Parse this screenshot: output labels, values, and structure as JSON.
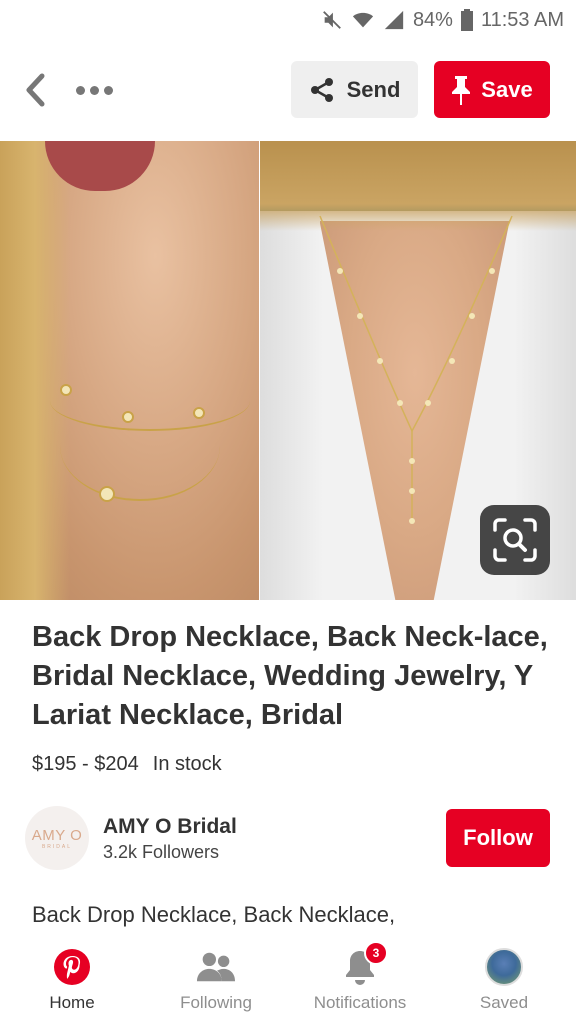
{
  "status_bar": {
    "battery": "84%",
    "time": "11:53 AM"
  },
  "toolbar": {
    "send_label": "Send",
    "save_label": "Save"
  },
  "pin": {
    "title": "Back Drop Necklace, Back Neck-lace, Bridal Necklace, Wedding Jewelry, Y Lariat Necklace, Bridal",
    "price": "$195 - $204",
    "stock": "In stock",
    "description": "Back Drop Necklace, Back Necklace,"
  },
  "creator": {
    "logo_text": "AMY O",
    "logo_sub": "BRIDAL",
    "name": "AMY O Bridal",
    "followers": "3.2k Followers",
    "follow_label": "Follow"
  },
  "bottom_nav": {
    "items": [
      {
        "label": "Home",
        "icon": "pinterest-logo-icon",
        "active": true
      },
      {
        "label": "Following",
        "icon": "people-icon",
        "active": false
      },
      {
        "label": "Notifications",
        "icon": "bell-icon",
        "active": false,
        "badge": "3"
      },
      {
        "label": "Saved",
        "icon": "profile-avatar",
        "active": false
      }
    ]
  },
  "colors": {
    "brand_red": "#e60023",
    "text_primary": "#333333",
    "text_secondary": "#8e8e8e"
  }
}
